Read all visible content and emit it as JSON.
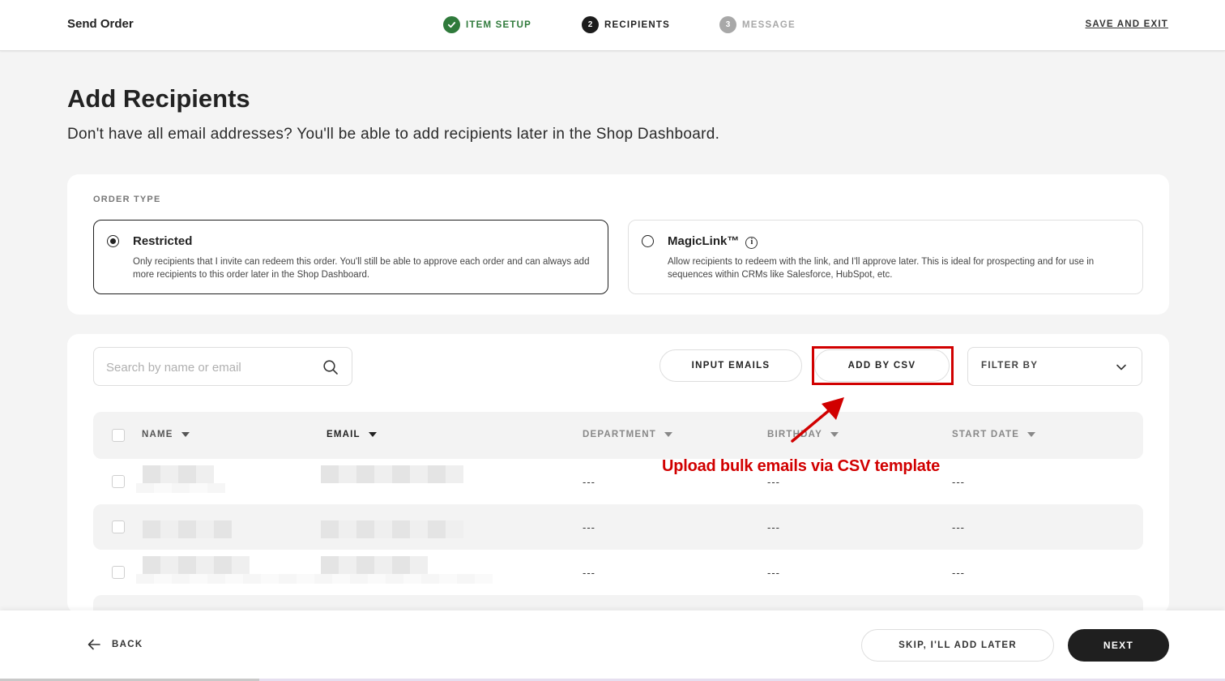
{
  "header": {
    "title": "Send Order",
    "steps": [
      {
        "number": "✓",
        "label": "ITEM SETUP",
        "state": "complete"
      },
      {
        "number": "2",
        "label": "RECIPIENTS",
        "state": "active"
      },
      {
        "number": "3",
        "label": "MESSAGE",
        "state": "upcoming"
      }
    ],
    "save_exit": "SAVE AND EXIT"
  },
  "page": {
    "title": "Add Recipients",
    "subtitle": "Don't have all email addresses? You'll be able to add recipients later in the Shop Dashboard."
  },
  "order_type": {
    "label": "ORDER TYPE",
    "options": [
      {
        "title": "Restricted",
        "description": "Only recipients that I invite can redeem this order. You'll still be able to approve each order and can always add more recipients to this order later in the Shop Dashboard.",
        "selected": true
      },
      {
        "title": "MagicLink™",
        "description": "Allow recipients to redeem with the link, and I'll approve later. This is ideal for prospecting and for use in sequences within CRMs like Salesforce, HubSpot, etc.",
        "selected": false
      }
    ]
  },
  "recipients": {
    "search_placeholder": "Search by name or email",
    "input_emails_label": "INPUT EMAILS",
    "add_csv_label": "ADD BY CSV",
    "filter_label": "FILTER BY",
    "columns": [
      "NAME",
      "EMAIL",
      "DEPARTMENT",
      "BIRTHDAY",
      "START DATE"
    ],
    "rows": [
      {
        "department": "---",
        "birthday": "---",
        "start_date": "---"
      },
      {
        "department": "---",
        "birthday": "---",
        "start_date": "---"
      },
      {
        "department": "---",
        "birthday": "---",
        "start_date": "---"
      }
    ]
  },
  "annotation": {
    "text": "Upload bulk emails via CSV template",
    "color": "#d10000"
  },
  "footer": {
    "back_label": "BACK",
    "skip_label": "SKIP, I'LL ADD LATER",
    "next_label": "NEXT"
  },
  "colors": {
    "accent_dark": "#1f1f1f",
    "step_complete": "#2f7a3b",
    "step_upcoming": "#a8a8a8",
    "annotation_red": "#d10000"
  }
}
